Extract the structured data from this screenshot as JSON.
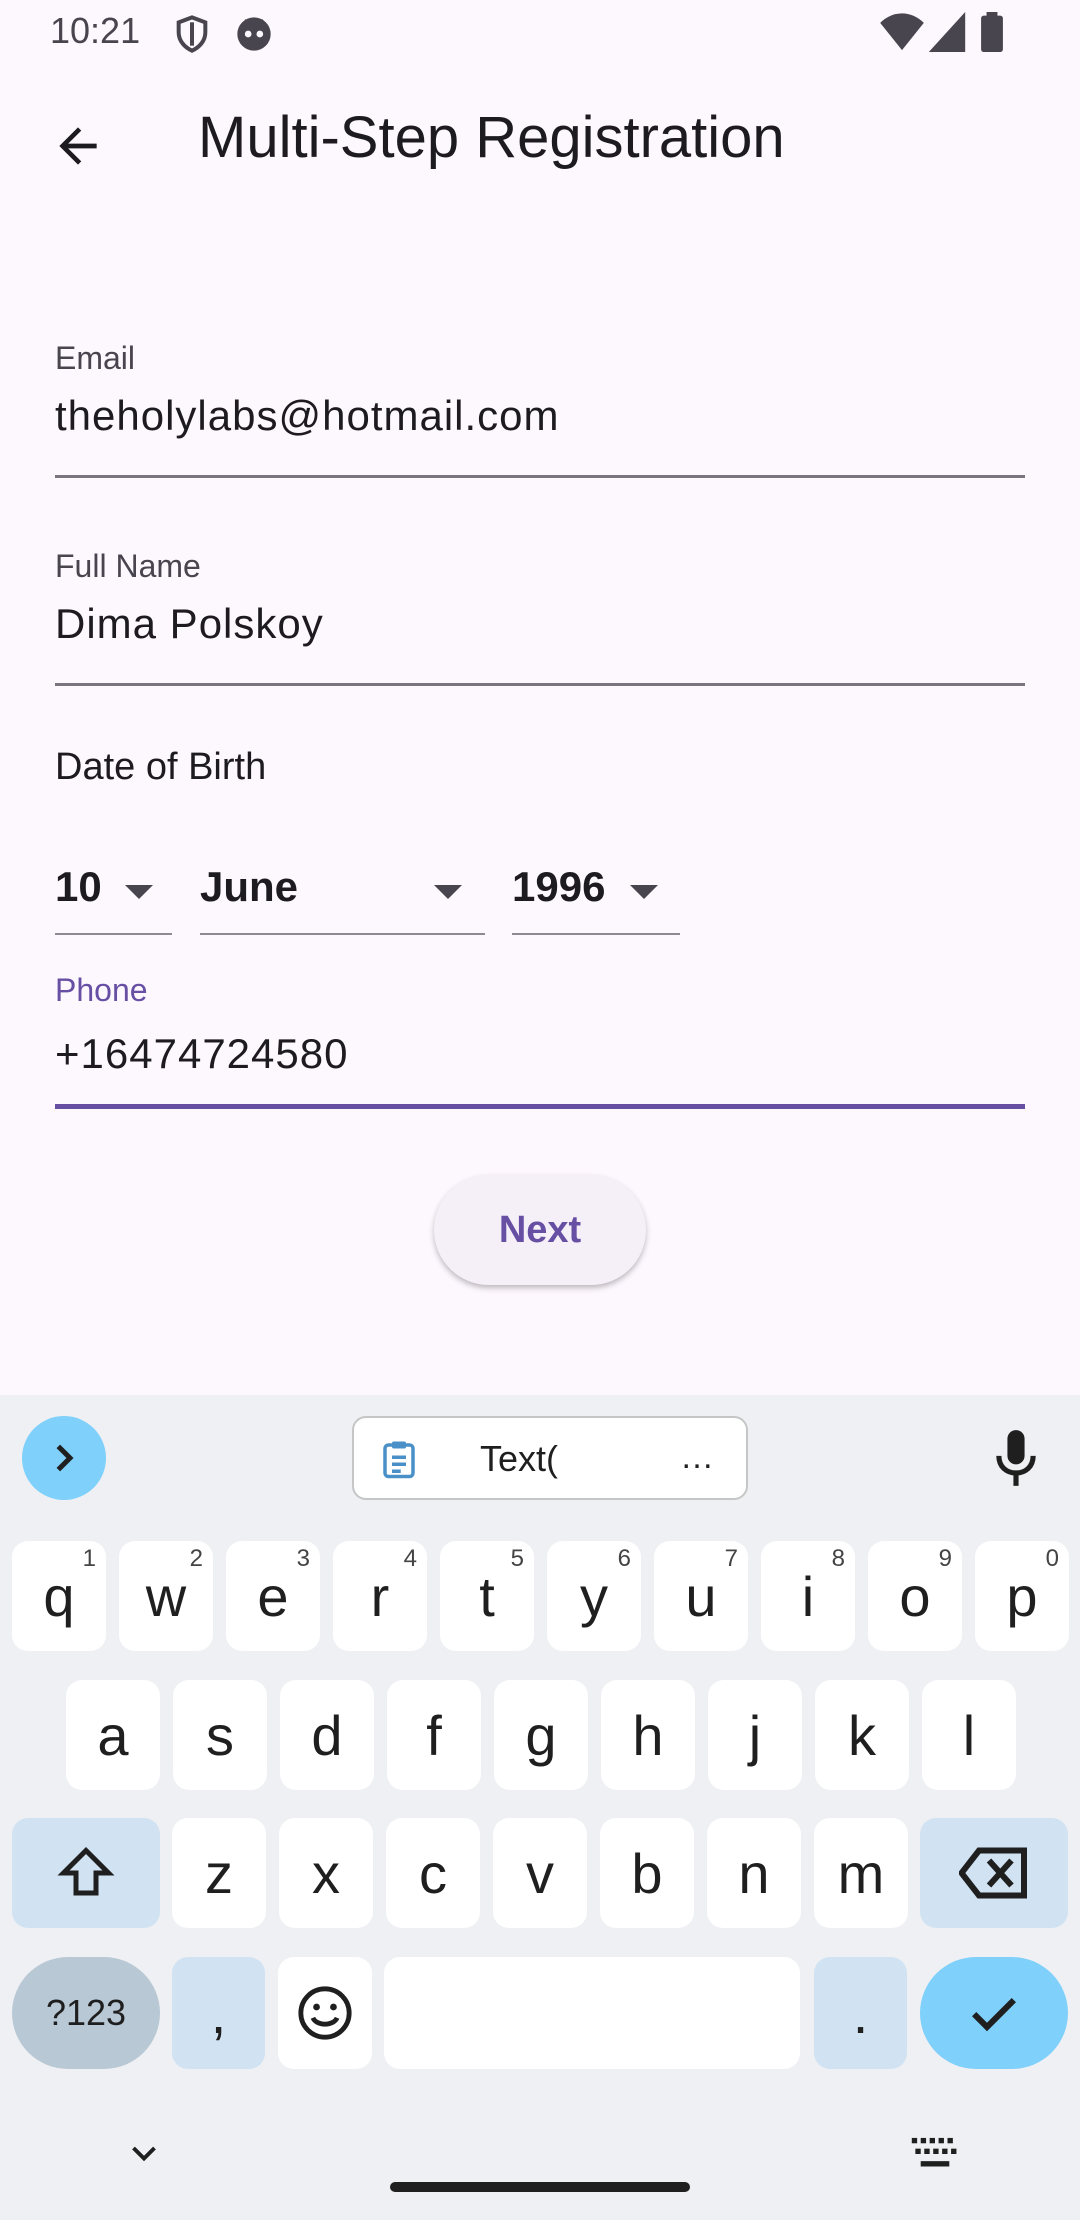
{
  "status_bar": {
    "time": "10:21"
  },
  "app_bar": {
    "title": "Multi-Step Registration"
  },
  "form": {
    "email": {
      "label": "Email",
      "value": "theholylabs@hotmail.com"
    },
    "full_name": {
      "label": "Full Name",
      "value": "Dima Polskoy"
    },
    "dob": {
      "label": "Date of Birth",
      "day": "10",
      "month": "June",
      "year": "1996"
    },
    "phone": {
      "label": "Phone",
      "value": "+16474724580"
    },
    "next_label": "Next"
  },
  "keyboard": {
    "suggestion": {
      "text": "Text(",
      "ellipsis": "…"
    },
    "row1": [
      {
        "k": "q",
        "n": "1"
      },
      {
        "k": "w",
        "n": "2"
      },
      {
        "k": "e",
        "n": "3"
      },
      {
        "k": "r",
        "n": "4"
      },
      {
        "k": "t",
        "n": "5"
      },
      {
        "k": "y",
        "n": "6"
      },
      {
        "k": "u",
        "n": "7"
      },
      {
        "k": "i",
        "n": "8"
      },
      {
        "k": "o",
        "n": "9"
      },
      {
        "k": "p",
        "n": "0"
      }
    ],
    "row2": [
      "a",
      "s",
      "d",
      "f",
      "g",
      "h",
      "j",
      "k",
      "l"
    ],
    "row3": [
      "z",
      "x",
      "c",
      "v",
      "b",
      "n",
      "m"
    ],
    "symbols_label": "?123",
    "comma": ",",
    "period": "."
  },
  "colors": {
    "accent": "#6750a4",
    "keyboard_blue": "#d1e3f3",
    "action_key": "#7fd0fb"
  }
}
